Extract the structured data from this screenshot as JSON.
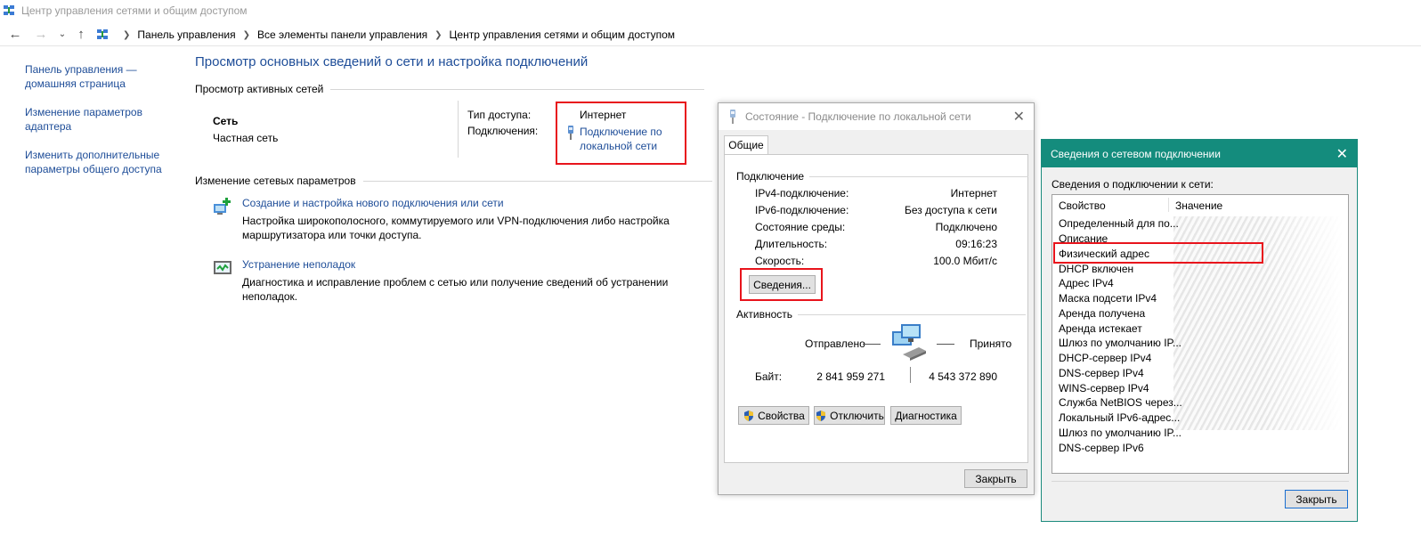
{
  "window": {
    "title": "Центр управления сетями и общим доступом"
  },
  "nav": {
    "back_icon": "arrow-left-icon",
    "forward_icon": "arrow-right-icon",
    "recent_icon": "chevron-down-icon",
    "up_icon": "arrow-up-icon"
  },
  "breadcrumb": [
    "Панель управления",
    "Все элементы панели управления",
    "Центр управления сетями и общим доступом"
  ],
  "sidebar": {
    "items": [
      "Панель управления — домашняя страница",
      "Изменение параметров адаптера",
      "Изменить дополнительные параметры общего доступа"
    ]
  },
  "main": {
    "title": "Просмотр основных сведений о сети и настройка подключений",
    "active_networks_heading": "Просмотр активных сетей",
    "network": {
      "name": "Сеть",
      "type": "Частная сеть",
      "access_label": "Тип доступа:",
      "access_value": "Интернет",
      "connections_label": "Подключения:",
      "connection_link": "Подключение по локальной сети"
    },
    "change_heading": "Изменение сетевых параметров",
    "tasks": [
      {
        "link": "Создание и настройка нового подключения или сети",
        "desc": "Настройка широкополосного, коммутируемого или VPN-подключения либо настройка маршрутизатора или точки доступа."
      },
      {
        "link": "Устранение неполадок",
        "desc": "Диагностика и исправление проблем с сетью или получение сведений об устранении неполадок."
      }
    ]
  },
  "status_dialog": {
    "title": "Состояние - Подключение по локальной сети",
    "tab": "Общие",
    "connection_group": "Подключение",
    "rows": [
      {
        "label": "IPv4-подключение:",
        "value": "Интернет"
      },
      {
        "label": "IPv6-подключение:",
        "value": "Без доступа к сети"
      },
      {
        "label": "Состояние среды:",
        "value": "Подключено"
      },
      {
        "label": "Длительность:",
        "value": "09:16:23"
      },
      {
        "label": "Скорость:",
        "value": "100.0 Мбит/с"
      }
    ],
    "details_button": "Сведения...",
    "activity_group": "Активность",
    "sent_label": "Отправлено",
    "received_label": "Принято",
    "bytes_label": "Байт:",
    "bytes_sent": "2 841 959 271",
    "bytes_received": "4 543 372 890",
    "properties_button": "Свойства",
    "disable_button": "Отключить",
    "diagnose_button": "Диагностика",
    "close_button": "Закрыть"
  },
  "details_dialog": {
    "title": "Сведения о сетевом подключении",
    "caption": "Сведения о подключении к сети:",
    "col_property": "Свойство",
    "col_value": "Значение",
    "properties": [
      "Определенный для по...",
      "Описание",
      "Физический адрес",
      "DHCP включен",
      "Адрес IPv4",
      "Маска подсети IPv4",
      "Аренда получена",
      "Аренда истекает",
      "Шлюз по умолчанию IP...",
      "DHCP-сервер IPv4",
      "DNS-сервер IPv4",
      "WINS-сервер IPv4",
      "Служба NetBIOS через...",
      "Локальный IPv6-адрес...",
      "Шлюз по умолчанию IP...",
      "DNS-сервер IPv6"
    ],
    "close_button": "Закрыть"
  },
  "colors": {
    "link": "#1e4d98",
    "highlight_box": "#e8141c",
    "details_titlebar": "#148c7d"
  }
}
